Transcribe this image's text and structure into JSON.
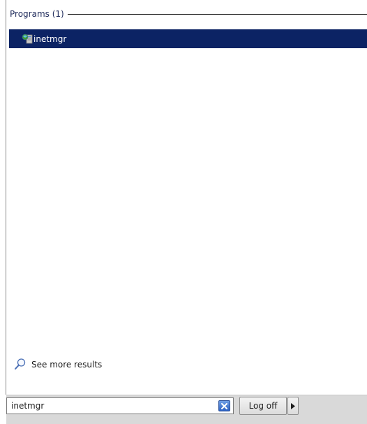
{
  "results": {
    "group_title": "Programs (1)",
    "items": [
      {
        "label": "inetmgr",
        "icon": "iis-manager-icon",
        "selected": true
      }
    ],
    "see_more_label": "See more results"
  },
  "search": {
    "value": "inetmgr",
    "clear_icon": "clear-x-icon"
  },
  "power": {
    "logoff_label": "Log off",
    "arrow_icon": "triangle-right-icon"
  },
  "colors": {
    "selection": "#0c2364",
    "bottom_bar": "#d9d9d9",
    "clear_button": "#2e63c4"
  }
}
